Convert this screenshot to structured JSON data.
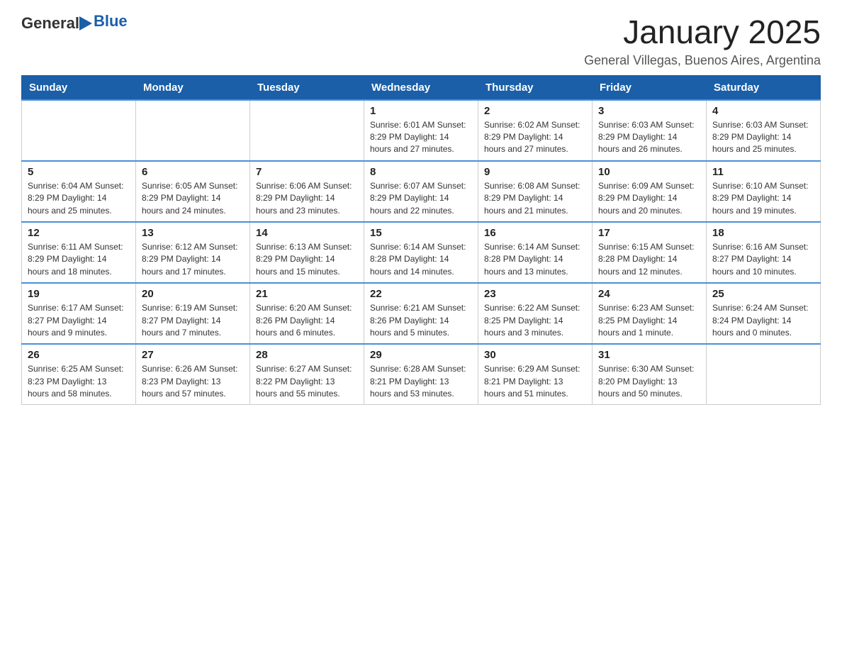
{
  "header": {
    "logo_general": "General",
    "logo_blue": "Blue",
    "month_year": "January 2025",
    "location": "General Villegas, Buenos Aires, Argentina"
  },
  "days_of_week": [
    "Sunday",
    "Monday",
    "Tuesday",
    "Wednesday",
    "Thursday",
    "Friday",
    "Saturday"
  ],
  "weeks": [
    [
      {
        "day": "",
        "info": ""
      },
      {
        "day": "",
        "info": ""
      },
      {
        "day": "",
        "info": ""
      },
      {
        "day": "1",
        "info": "Sunrise: 6:01 AM\nSunset: 8:29 PM\nDaylight: 14 hours\nand 27 minutes."
      },
      {
        "day": "2",
        "info": "Sunrise: 6:02 AM\nSunset: 8:29 PM\nDaylight: 14 hours\nand 27 minutes."
      },
      {
        "day": "3",
        "info": "Sunrise: 6:03 AM\nSunset: 8:29 PM\nDaylight: 14 hours\nand 26 minutes."
      },
      {
        "day": "4",
        "info": "Sunrise: 6:03 AM\nSunset: 8:29 PM\nDaylight: 14 hours\nand 25 minutes."
      }
    ],
    [
      {
        "day": "5",
        "info": "Sunrise: 6:04 AM\nSunset: 8:29 PM\nDaylight: 14 hours\nand 25 minutes."
      },
      {
        "day": "6",
        "info": "Sunrise: 6:05 AM\nSunset: 8:29 PM\nDaylight: 14 hours\nand 24 minutes."
      },
      {
        "day": "7",
        "info": "Sunrise: 6:06 AM\nSunset: 8:29 PM\nDaylight: 14 hours\nand 23 minutes."
      },
      {
        "day": "8",
        "info": "Sunrise: 6:07 AM\nSunset: 8:29 PM\nDaylight: 14 hours\nand 22 minutes."
      },
      {
        "day": "9",
        "info": "Sunrise: 6:08 AM\nSunset: 8:29 PM\nDaylight: 14 hours\nand 21 minutes."
      },
      {
        "day": "10",
        "info": "Sunrise: 6:09 AM\nSunset: 8:29 PM\nDaylight: 14 hours\nand 20 minutes."
      },
      {
        "day": "11",
        "info": "Sunrise: 6:10 AM\nSunset: 8:29 PM\nDaylight: 14 hours\nand 19 minutes."
      }
    ],
    [
      {
        "day": "12",
        "info": "Sunrise: 6:11 AM\nSunset: 8:29 PM\nDaylight: 14 hours\nand 18 minutes."
      },
      {
        "day": "13",
        "info": "Sunrise: 6:12 AM\nSunset: 8:29 PM\nDaylight: 14 hours\nand 17 minutes."
      },
      {
        "day": "14",
        "info": "Sunrise: 6:13 AM\nSunset: 8:29 PM\nDaylight: 14 hours\nand 15 minutes."
      },
      {
        "day": "15",
        "info": "Sunrise: 6:14 AM\nSunset: 8:28 PM\nDaylight: 14 hours\nand 14 minutes."
      },
      {
        "day": "16",
        "info": "Sunrise: 6:14 AM\nSunset: 8:28 PM\nDaylight: 14 hours\nand 13 minutes."
      },
      {
        "day": "17",
        "info": "Sunrise: 6:15 AM\nSunset: 8:28 PM\nDaylight: 14 hours\nand 12 minutes."
      },
      {
        "day": "18",
        "info": "Sunrise: 6:16 AM\nSunset: 8:27 PM\nDaylight: 14 hours\nand 10 minutes."
      }
    ],
    [
      {
        "day": "19",
        "info": "Sunrise: 6:17 AM\nSunset: 8:27 PM\nDaylight: 14 hours\nand 9 minutes."
      },
      {
        "day": "20",
        "info": "Sunrise: 6:19 AM\nSunset: 8:27 PM\nDaylight: 14 hours\nand 7 minutes."
      },
      {
        "day": "21",
        "info": "Sunrise: 6:20 AM\nSunset: 8:26 PM\nDaylight: 14 hours\nand 6 minutes."
      },
      {
        "day": "22",
        "info": "Sunrise: 6:21 AM\nSunset: 8:26 PM\nDaylight: 14 hours\nand 5 minutes."
      },
      {
        "day": "23",
        "info": "Sunrise: 6:22 AM\nSunset: 8:25 PM\nDaylight: 14 hours\nand 3 minutes."
      },
      {
        "day": "24",
        "info": "Sunrise: 6:23 AM\nSunset: 8:25 PM\nDaylight: 14 hours\nand 1 minute."
      },
      {
        "day": "25",
        "info": "Sunrise: 6:24 AM\nSunset: 8:24 PM\nDaylight: 14 hours\nand 0 minutes."
      }
    ],
    [
      {
        "day": "26",
        "info": "Sunrise: 6:25 AM\nSunset: 8:23 PM\nDaylight: 13 hours\nand 58 minutes."
      },
      {
        "day": "27",
        "info": "Sunrise: 6:26 AM\nSunset: 8:23 PM\nDaylight: 13 hours\nand 57 minutes."
      },
      {
        "day": "28",
        "info": "Sunrise: 6:27 AM\nSunset: 8:22 PM\nDaylight: 13 hours\nand 55 minutes."
      },
      {
        "day": "29",
        "info": "Sunrise: 6:28 AM\nSunset: 8:21 PM\nDaylight: 13 hours\nand 53 minutes."
      },
      {
        "day": "30",
        "info": "Sunrise: 6:29 AM\nSunset: 8:21 PM\nDaylight: 13 hours\nand 51 minutes."
      },
      {
        "day": "31",
        "info": "Sunrise: 6:30 AM\nSunset: 8:20 PM\nDaylight: 13 hours\nand 50 minutes."
      },
      {
        "day": "",
        "info": ""
      }
    ]
  ]
}
